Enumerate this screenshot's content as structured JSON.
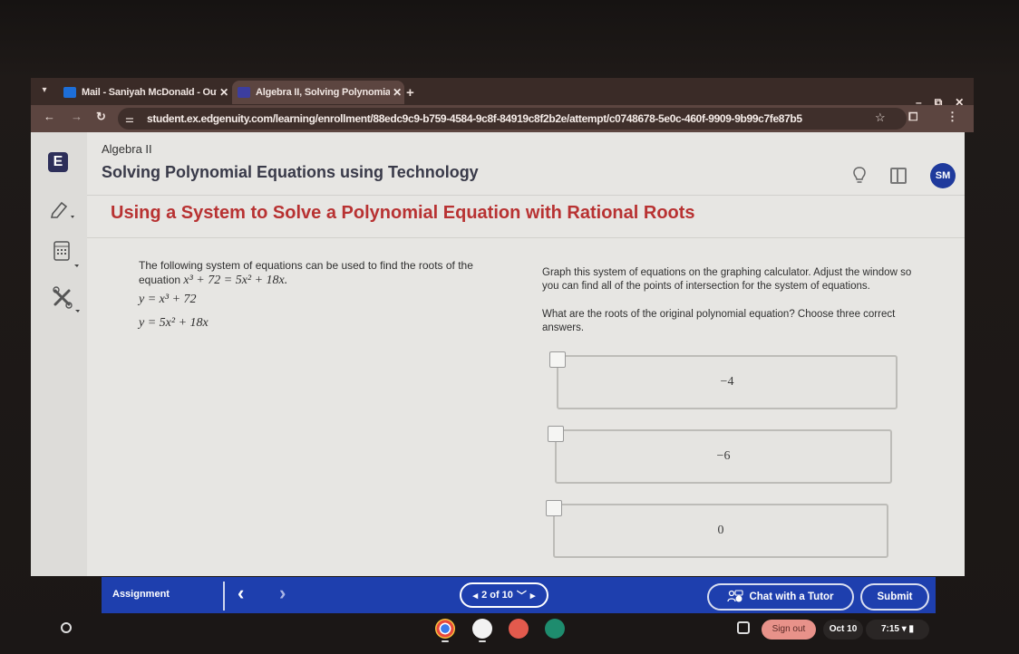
{
  "browser": {
    "tabs": [
      {
        "title": "Mail - Saniyah McDonald - Out",
        "favicon": "outlook-icon",
        "active": false
      },
      {
        "title": "Algebra II, Solving Polynomial I",
        "favicon": "edgenuity-icon",
        "active": true
      }
    ],
    "new_tab": "+",
    "close_glyph": "✕",
    "tab_list_glyph": "▾",
    "window_controls": {
      "minimize": "–",
      "restore": "⧉",
      "close": "✕"
    },
    "nav": {
      "back": "←",
      "forward": "→",
      "reload": "↻"
    },
    "site_settings_glyph": "⚌",
    "url": "student.ex.edgenuity.com/learning/enrollment/88edc9c9-b759-4584-9c8f-84919c8f2b2e/attempt/c0748678-5e0c-460f-9909-9b99c7fe87b5",
    "bookmark_glyph": "☆",
    "extensions_glyph": "⧠",
    "menu_glyph": "⋮"
  },
  "header": {
    "logo_letter": "E",
    "course": "Algebra II",
    "lesson": "Solving Polynomial Equations using Technology",
    "avatar_initials": "SM",
    "hint_glyph": "💡"
  },
  "activity": {
    "title": "Using a System to Solve a Polynomial Equation with Rational Roots"
  },
  "sidebar_tools": [
    "highlighter-icon",
    "calculator-icon",
    "tools-icon"
  ],
  "question": {
    "intro": "The following system of equations can be used to find the roots of the equation",
    "equation": "x³ + 72 = 5x² + 18x.",
    "system": [
      "y = x³ + 72",
      "y = 5x² + 18x"
    ],
    "instruction": "Graph this system of equations on the graphing calculator. Adjust the window so you can find all of the points of intersection for the system of equations.",
    "prompt": "What are the roots of the original polynomial equation? Choose three correct answers.",
    "choices": [
      {
        "value": "−4",
        "checked": false
      },
      {
        "value": "−6",
        "checked": false
      },
      {
        "value": "0",
        "checked": false
      }
    ]
  },
  "footer": {
    "assignment_label": "Assignment",
    "prev_glyph": "‹",
    "next_glyph": "›",
    "pager": {
      "current": 2,
      "total": 10,
      "text": "2 of 10"
    },
    "chat_label": "Chat with a Tutor",
    "submit_label": "Submit"
  },
  "shelf": {
    "apps": [
      "chrome-icon",
      "outlook-icon",
      "canvas-icon",
      "classroom-icon"
    ],
    "sign_out_label": "Sign out",
    "date": "Oct 10",
    "time": "7:15"
  }
}
